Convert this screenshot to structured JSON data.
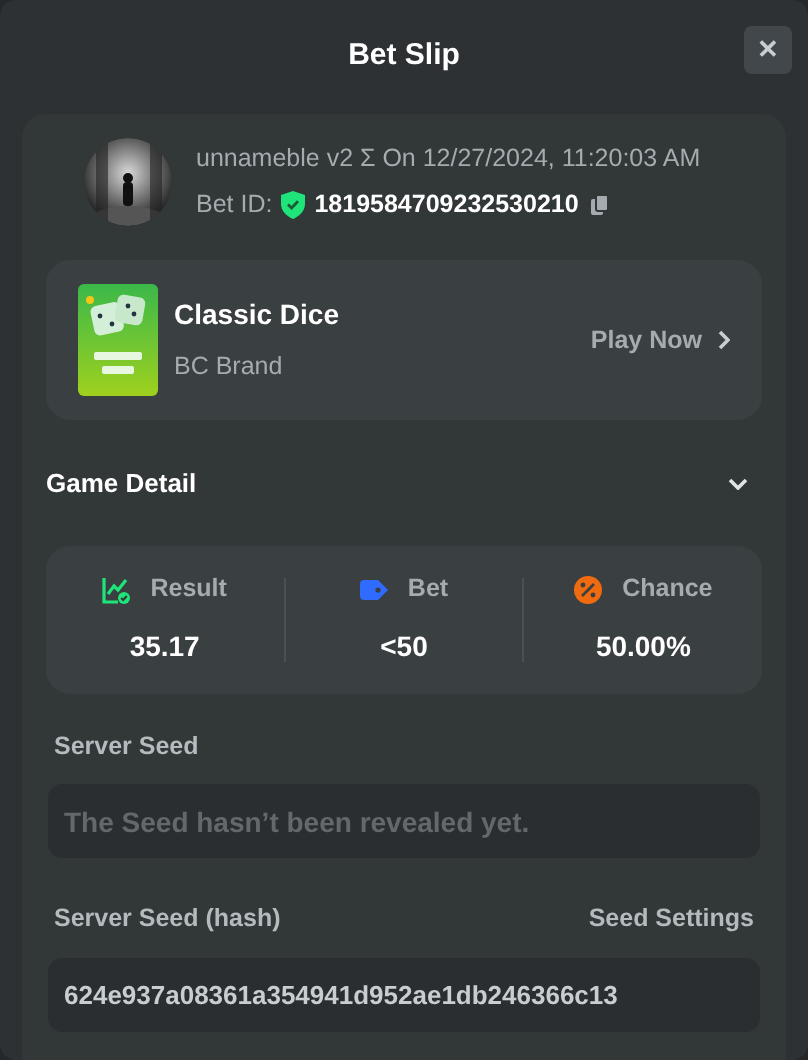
{
  "window": {
    "title": "Bet Slip",
    "close": "✕"
  },
  "bet": {
    "meta": "unnameble v2 Σ On 12/27/2024, 11:20:03 AM",
    "id_label": "Bet ID:",
    "id": "1819584709232530210"
  },
  "game": {
    "title": "Classic Dice",
    "provider": "BC Brand",
    "action": "Play Now"
  },
  "game_detail": {
    "title": "Game Detail",
    "expanded": true
  },
  "stats": [
    {
      "kind": "result",
      "label": "Result",
      "value": "35.17"
    },
    {
      "kind": "bet",
      "label": "Bet",
      "value": "<50"
    },
    {
      "kind": "chance",
      "label": "Chance",
      "value": "50.00%"
    }
  ],
  "server_seed": {
    "label": "Server Seed",
    "placeholder": "The Seed hasn’t been revealed yet."
  },
  "server_seed_hash": {
    "label": "Server Seed (hash)",
    "link": "Seed Settings",
    "value": "624e937a08361a354941d952ae1db246366c13"
  }
}
